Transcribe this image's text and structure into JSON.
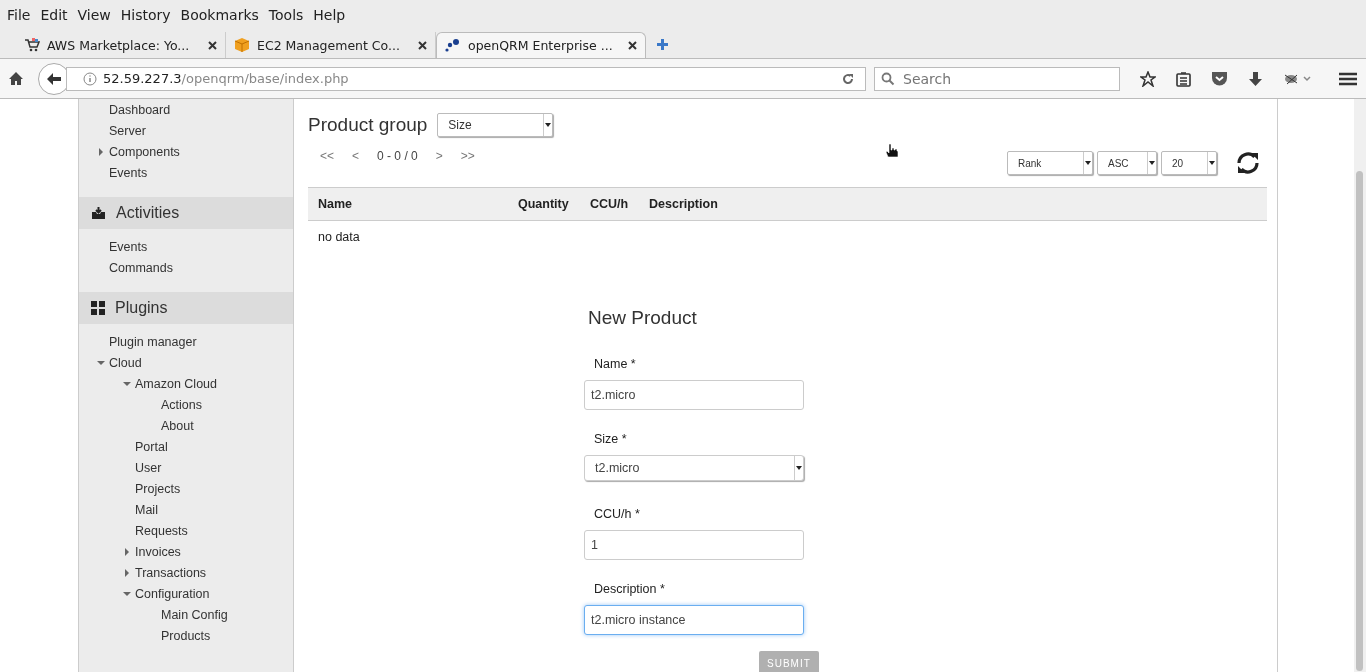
{
  "menu_bar": [
    "File",
    "Edit",
    "View",
    "History",
    "Bookmarks",
    "Tools",
    "Help"
  ],
  "tabs": [
    {
      "title": "AWS Marketplace: Yo...",
      "selected": false
    },
    {
      "title": "EC2 Management Co...",
      "selected": false
    },
    {
      "title": "openQRM Enterprise ...",
      "selected": true
    }
  ],
  "address_bar": {
    "host": "52.59.227.3",
    "path": "/openqrm/base/index.php"
  },
  "search": {
    "placeholder": "Search"
  },
  "sidebar": {
    "sections": [
      {
        "items": [
          {
            "label": "Dashboard"
          },
          {
            "label": "Server"
          },
          {
            "label": "Components",
            "expanded": false
          },
          {
            "label": "Events"
          }
        ]
      },
      {
        "title": "Activities",
        "items": [
          {
            "label": "Events"
          },
          {
            "label": "Commands"
          }
        ]
      },
      {
        "title": "Plugins",
        "items": [
          {
            "label": "Plugin manager"
          },
          {
            "label": "Cloud",
            "expanded": true,
            "children": [
              {
                "label": "Amazon Cloud",
                "expanded": true,
                "children": [
                  {
                    "label": "Actions"
                  },
                  {
                    "label": "About"
                  }
                ]
              },
              {
                "label": "Portal"
              },
              {
                "label": "User"
              },
              {
                "label": "Projects"
              },
              {
                "label": "Mail"
              },
              {
                "label": "Requests"
              },
              {
                "label": "Invoices",
                "expanded": false
              },
              {
                "label": "Transactions",
                "expanded": false
              },
              {
                "label": "Configuration",
                "expanded": true,
                "children": [
                  {
                    "label": "Main Config"
                  },
                  {
                    "label": "Products"
                  }
                ]
              }
            ]
          }
        ]
      }
    ]
  },
  "product_group": {
    "label": "Product group",
    "value": "Size"
  },
  "pager": {
    "first": "<<",
    "prev": "<",
    "range": "0 - 0 / 0",
    "next": ">",
    "last": ">>"
  },
  "sort": {
    "field": "Rank",
    "order": "ASC",
    "per_page": "20"
  },
  "table": {
    "columns": [
      "Name",
      "Quantity",
      "CCU/h",
      "Description"
    ],
    "empty": "no data"
  },
  "form": {
    "title": "New Product",
    "fields": [
      {
        "label": "Name *",
        "kind": "text",
        "value": "t2.micro",
        "focused": false
      },
      {
        "label": "Size *",
        "kind": "select",
        "value": "t2.micro",
        "focused": false
      },
      {
        "label": "CCU/h *",
        "kind": "text",
        "value": "1",
        "focused": false
      },
      {
        "label": "Description *",
        "kind": "text",
        "value": "t2.micro instance",
        "focused": true
      }
    ],
    "submit": {
      "label": "SUBMIT",
      "disabled": true
    }
  }
}
